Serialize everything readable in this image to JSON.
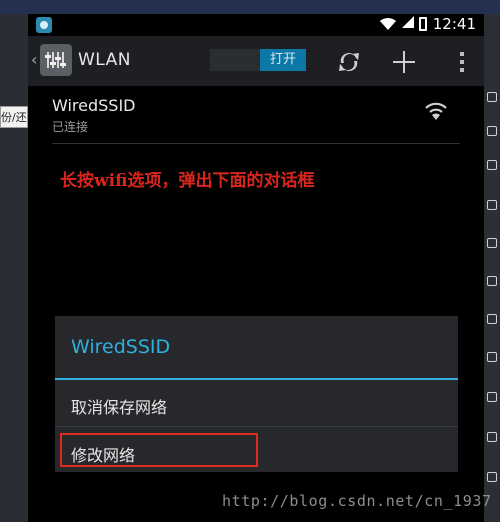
{
  "left_panel": {
    "item_label": "份/还"
  },
  "statusbar": {
    "time": "12:41"
  },
  "actionbar": {
    "back_glyph": "‹",
    "title": "WLAN",
    "toggle_label": "打开",
    "icons": [
      "settings-icon",
      "sync-icon",
      "add-icon",
      "overflow-menu-icon"
    ]
  },
  "network": {
    "ssid": "WiredSSID",
    "status": "已连接"
  },
  "annotation": "长按wifi选项，弹出下面的对话框",
  "dialog": {
    "title": "WiredSSID",
    "items": [
      "取消保存网络",
      "修改网络"
    ]
  },
  "watermark": "http://blog.csdn.net/cn_1937",
  "colors": {
    "accent": "#2fb0e0",
    "toggle_on": "#0b78a8",
    "annotation": "#d9261c",
    "highlight": "#e02a20"
  }
}
